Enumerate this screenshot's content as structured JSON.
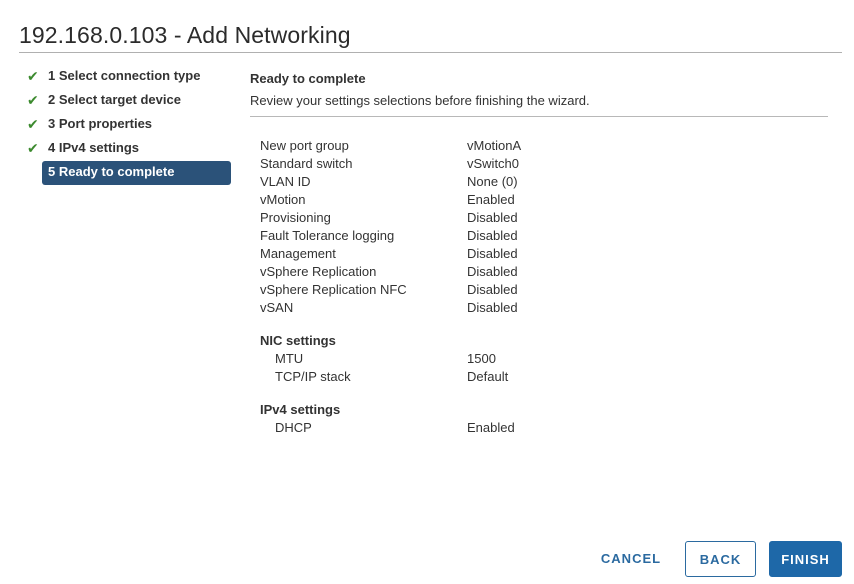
{
  "window": {
    "title": "192.168.0.103 - Add Networking"
  },
  "steps": [
    {
      "label": "1 Select connection type",
      "status": "done",
      "icon": "checkmark-icon"
    },
    {
      "label": "2 Select target device",
      "status": "done",
      "icon": "checkmark-icon"
    },
    {
      "label": "3 Port properties",
      "status": "done",
      "icon": "checkmark-icon"
    },
    {
      "label": "4 IPv4 settings",
      "status": "done",
      "icon": "checkmark-icon"
    },
    {
      "label": "5 Ready to complete",
      "status": "active"
    }
  ],
  "content": {
    "heading": "Ready to complete",
    "description": "Review your settings selections before finishing the wizard."
  },
  "summary": {
    "general": [
      {
        "key": "New port group",
        "value": "vMotionA"
      },
      {
        "key": "Standard switch",
        "value": "vSwitch0"
      },
      {
        "key": "VLAN ID",
        "value": "None (0)"
      },
      {
        "key": "vMotion",
        "value": "Enabled"
      },
      {
        "key": "Provisioning",
        "value": "Disabled"
      },
      {
        "key": "Fault Tolerance logging",
        "value": "Disabled"
      },
      {
        "key": "Management",
        "value": "Disabled"
      },
      {
        "key": "vSphere Replication",
        "value": "Disabled"
      },
      {
        "key": "vSphere Replication NFC",
        "value": "Disabled"
      },
      {
        "key": "vSAN",
        "value": "Disabled"
      }
    ],
    "nic_settings": {
      "title": "NIC settings",
      "rows": [
        {
          "key": "MTU",
          "value": "1500"
        },
        {
          "key": "TCP/IP stack",
          "value": "Default"
        }
      ]
    },
    "ipv4_settings": {
      "title": "IPv4 settings",
      "rows": [
        {
          "key": "DHCP",
          "value": "Enabled"
        }
      ]
    }
  },
  "footer": {
    "cancel_label": "CANCEL",
    "back_label": "BACK",
    "finish_label": "FINISH"
  },
  "colors": {
    "accent": "#1e68a8",
    "active_step_bg": "#2b5279",
    "check": "#3c8a2e"
  }
}
